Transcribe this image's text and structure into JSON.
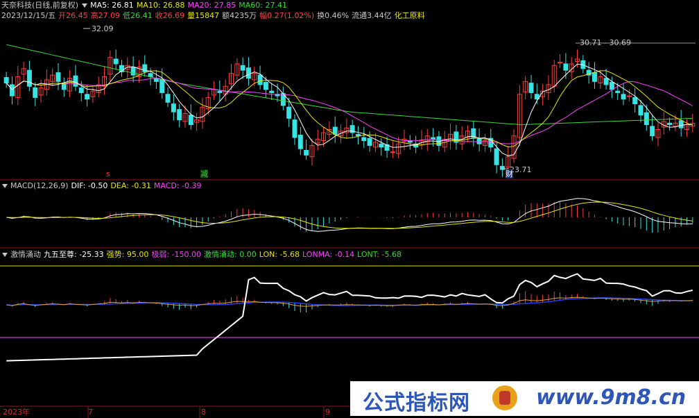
{
  "header": {
    "stock_name": "天奈科技(日线,前复权)",
    "ma_items": [
      {
        "label": "MA5: 26.81",
        "color": "#ffffff"
      },
      {
        "label": "MA10: 26.88",
        "color": "#e6e600"
      },
      {
        "label": "MA20: 27.85",
        "color": "#ff40ff"
      },
      {
        "label": "MA60: 27.41",
        "color": "#3cd83c"
      }
    ],
    "quote_items": [
      {
        "label": "2023/12/15/五",
        "color": "#c8c8c8"
      },
      {
        "label": "开26.45",
        "color": "#ff4040"
      },
      {
        "label": "高27.09",
        "color": "#ff4040"
      },
      {
        "label": "低26.41",
        "color": "#3cd83c"
      },
      {
        "label": "收26.69",
        "color": "#ff4040"
      },
      {
        "label": "量15847",
        "color": "#e6e600"
      },
      {
        "label": "额4235万",
        "color": "#c8c8c8"
      },
      {
        "label": "幅0.27(1.02%)",
        "color": "#ff4040"
      },
      {
        "label": "换0.46%",
        "color": "#c8c8c8"
      },
      {
        "label": "流通3.44亿",
        "color": "#c8c8c8"
      },
      {
        "label": "化工原料",
        "color": "#e6e600"
      }
    ]
  },
  "annotations": {
    "high_left": "32.09",
    "high_right": "30.71 - 30.69",
    "low": "23.71",
    "marker_s": "s",
    "marker_jian": "减",
    "marker_cai": "财"
  },
  "macd_header": [
    {
      "label": "MACD(12,26,9)",
      "color": "#c8c8c8"
    },
    {
      "label": "DIF: -0.50",
      "color": "#ffffff"
    },
    {
      "label": "DEA: -0.31",
      "color": "#e6e600"
    },
    {
      "label": "MACD: -0.39",
      "color": "#ff40ff"
    }
  ],
  "ind_header": [
    {
      "label": "激情涌动",
      "color": "#c8c8c8"
    },
    {
      "label": "九五至尊: -25.33",
      "color": "#ffffff"
    },
    {
      "label": "强势: 95.00",
      "color": "#e6e600"
    },
    {
      "label": "极弱: -150.00",
      "color": "#ff40ff"
    },
    {
      "label": "激情涌动: 0.00",
      "color": "#3cd83c"
    },
    {
      "label": "LON: -5.68",
      "color": "#e6e600"
    },
    {
      "label": "LONMA: -0.14",
      "color": "#ff40ff"
    },
    {
      "label": "LONT: -5.68",
      "color": "#3cd83c"
    }
  ],
  "xaxis": {
    "labels": [
      "2023年",
      "7",
      "8",
      "9"
    ]
  },
  "watermark": {
    "text": "公式指标网",
    "url": "www.9m8.cn"
  },
  "chart_data": {
    "type": "candlestick",
    "closes": [
      29.2,
      28.4,
      29.6,
      30.1,
      29.0,
      28.3,
      28.9,
      29.4,
      29.7,
      29.3,
      28.8,
      29.5,
      29.0,
      28.6,
      28.2,
      28.7,
      29.1,
      29.6,
      30.8,
      30.4,
      29.9,
      30.3,
      29.7,
      30.2,
      29.9,
      29.6,
      29.3,
      28.6,
      28.0,
      27.4,
      26.9,
      27.3,
      26.6,
      26.9,
      27.7,
      28.3,
      28.8,
      28.6,
      29.0,
      29.8,
      30.4,
      30.0,
      29.5,
      29.8,
      29.1,
      28.8,
      28.6,
      28.4,
      27.8,
      27.0,
      25.8,
      25.1,
      24.7,
      25.3,
      25.7,
      26.1,
      26.3,
      26.0,
      26.2,
      26.4,
      26.1,
      25.9,
      25.6,
      25.3,
      25.5,
      25.2,
      25.0,
      24.9,
      25.4,
      25.7,
      25.5,
      25.2,
      25.6,
      25.9,
      25.7,
      25.3,
      25.7,
      26.0,
      25.5,
      25.9,
      26.2,
      25.8,
      25.4,
      25.6,
      25.2,
      24.1,
      23.8,
      24.6,
      25.9,
      28.5,
      29.3,
      28.6,
      28.2,
      28.7,
      29.1,
      30.3,
      30.5,
      30.0,
      30.4,
      30.7,
      30.1,
      29.7,
      29.3,
      29.6,
      29.1,
      28.8,
      28.6,
      28.2,
      28.4,
      27.9,
      27.2,
      26.6,
      25.9,
      26.3,
      26.8,
      26.6,
      26.7,
      26.4,
      26.6,
      26.69
    ],
    "ma5_last": 26.81,
    "ma10_last": 26.88,
    "ma20_last": 27.85,
    "ma60_last": 27.41,
    "dif": -0.5,
    "dea": -0.31,
    "macd": -0.39,
    "indicator": {
      "jiuwu": -25.33,
      "qiangshi": 95.0,
      "jiruo": -150.0,
      "jiqing": 0.0,
      "lon": -5.68,
      "lonma": -0.14,
      "lont": -5.68
    },
    "price_range": [
      23.2,
      33.0
    ]
  }
}
